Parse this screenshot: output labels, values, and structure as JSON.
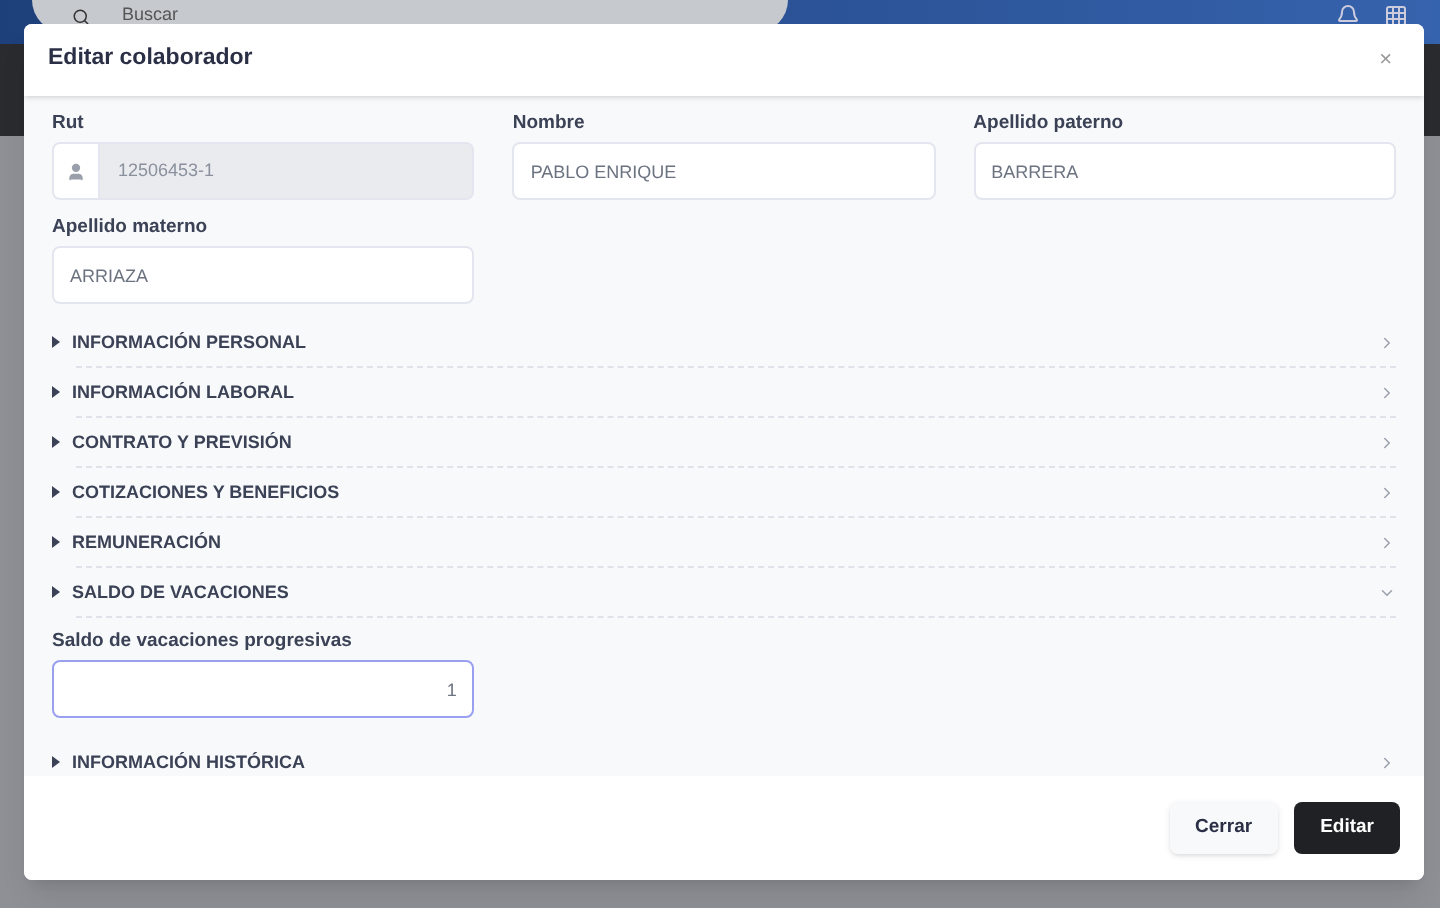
{
  "topbar": {
    "search": {
      "placeholder": "Buscar"
    }
  },
  "modal": {
    "title": "Editar colaborador",
    "close": "×",
    "fields": [
      {
        "label": "Rut",
        "value": "12506453-1",
        "disabled": true
      },
      {
        "label": "Nombre",
        "value": "PABLO ENRIQUE",
        "disabled": false
      },
      {
        "label": "Apellido paterno",
        "value": "BARRERA",
        "disabled": false
      },
      {
        "label": "Apellido materno",
        "value": "ARRIAZA",
        "disabled": false
      }
    ],
    "sections": [
      {
        "title": "INFORMACIÓN PERSONAL",
        "expanded": false
      },
      {
        "title": "INFORMACIÓN LABORAL",
        "expanded": false
      },
      {
        "title": "CONTRATO Y PREVISIÓN",
        "expanded": false
      },
      {
        "title": "COTIZACIONES Y BENEFICIOS",
        "expanded": false
      },
      {
        "title": "REMUNERACIÓN",
        "expanded": false
      },
      {
        "title": "SALDO DE VACACIONES",
        "expanded": true,
        "fields": [
          {
            "label": "Saldo de vacaciones progresivas",
            "value": "1",
            "focused": true
          }
        ]
      },
      {
        "title": "INFORMACIÓN HISTÓRICA",
        "expanded": false
      }
    ],
    "buttons": [
      {
        "label": "Cerrar",
        "kind": "secondary"
      },
      {
        "label": "Editar",
        "kind": "primary"
      }
    ]
  }
}
